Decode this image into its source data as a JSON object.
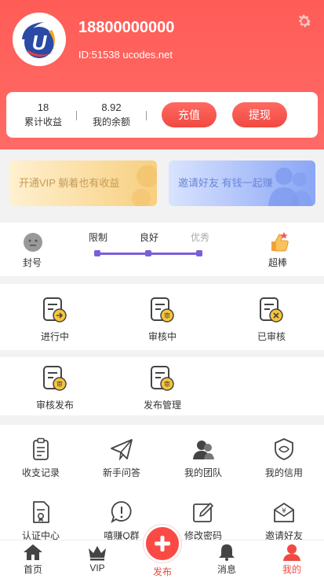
{
  "profile": {
    "phone": "18800000000",
    "uid_text": "ID:51538 ucodes.net"
  },
  "stats": {
    "earnings_value": "18",
    "earnings_label": "累计收益",
    "balance_value": "8.92",
    "balance_label": "我的余额",
    "recharge_label": "充值",
    "withdraw_label": "提现"
  },
  "banners": {
    "vip": "开通VIP 躺着也有收益",
    "invite": "邀请好友 有钱一起赚"
  },
  "credit": {
    "left_label": "封号",
    "right_label": "超棒",
    "levels": [
      "限制",
      "良好",
      "优秀"
    ],
    "current_level": "良好"
  },
  "tasks_row1": [
    {
      "label": "进行中",
      "icon": "task-in-progress-icon"
    },
    {
      "label": "审核中",
      "icon": "task-reviewing-icon"
    },
    {
      "label": "已审核",
      "icon": "task-reviewed-icon"
    }
  ],
  "tasks_row2": [
    {
      "label": "审核发布",
      "icon": "review-publish-icon"
    },
    {
      "label": "发布管理",
      "icon": "publish-manage-icon"
    }
  ],
  "tools_row1": [
    {
      "label": "收支记录",
      "icon": "records-icon"
    },
    {
      "label": "新手问答",
      "icon": "paper-plane-icon"
    },
    {
      "label": "我的团队",
      "icon": "team-icon"
    },
    {
      "label": "我的信用",
      "icon": "credit-shield-icon"
    }
  ],
  "tools_row2": [
    {
      "label": "认证中心",
      "icon": "certification-icon"
    },
    {
      "label": "嘻赚Q群",
      "icon": "qq-group-icon"
    },
    {
      "label": "修改密码",
      "icon": "edit-password-icon"
    },
    {
      "label": "邀请好友",
      "icon": "invite-icon"
    }
  ],
  "tabbar": {
    "home": "首页",
    "vip": "VIP",
    "publish": "发布",
    "messages": "消息",
    "mine": "我的"
  },
  "colors": {
    "brand_red": "#fb4a45",
    "active_tab": "#f04a42",
    "slider_purple": "#7b5fd9"
  }
}
